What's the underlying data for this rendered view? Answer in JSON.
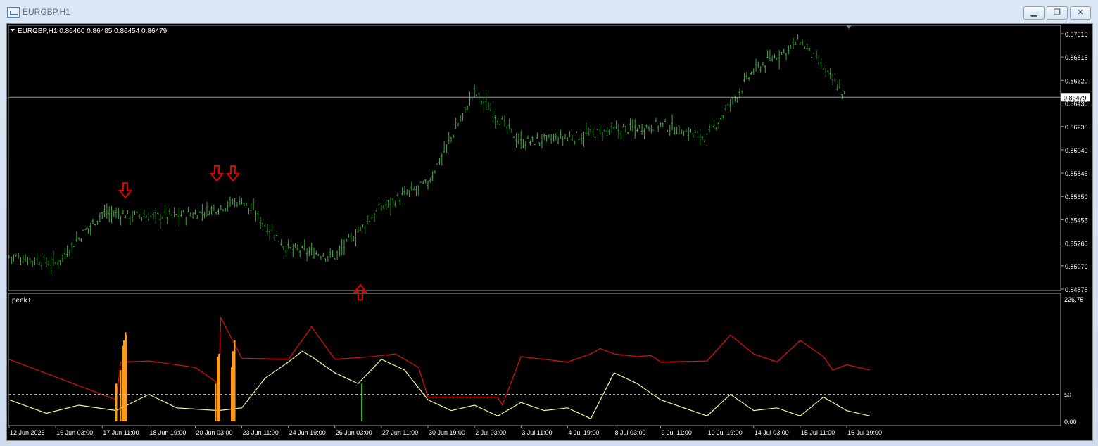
{
  "window": {
    "title": "EURGBP,H1"
  },
  "symbol_info": {
    "text": "EURGBP,H1  0.86460 0.86485 0.86454 0.86479"
  },
  "price_axis": {
    "ticks": [
      "0.87010",
      "0.86815",
      "0.86620",
      "0.86430",
      "0.86235",
      "0.86040",
      "0.85845",
      "0.85650",
      "0.85455",
      "0.85260",
      "0.85070",
      "0.84875"
    ],
    "current_price": "0.86479"
  },
  "indicator": {
    "name": "peek+",
    "ticks": [
      "226.75",
      "50",
      "0.00"
    ],
    "level_value": 50
  },
  "time_axis": {
    "labels": [
      "12 Jun 2025",
      "16 Jun 03:00",
      "17 Jun 11:00",
      "18 Jun 19:00",
      "20 Jun 03:00",
      "23 Jun 11:00",
      "24 Jun 19:00",
      "26 Jun 03:00",
      "27 Jun 11:00",
      "30 Jun 19:00",
      "2 Jul 03:00",
      "3 Jul 11:00",
      "4 Jul 19:00",
      "8 Jul 03:00",
      "9 Jul 11:00",
      "10 Jul 19:00",
      "14 Jul 03:00",
      "15 Jul 11:00",
      "16 Jul 19:00"
    ]
  },
  "colors": {
    "price_bars": "#3fae3a",
    "arrows": "#e00000",
    "indicator_red": "#e01010",
    "indicator_yellow": "#f4f4a0",
    "indicator_orange": "#ff9a1a",
    "indicator_green": "#21c021",
    "background": "#000000"
  },
  "arrows": [
    {
      "type": "down",
      "time_index": 8.4
    },
    {
      "type": "down",
      "time_index": 14.7
    },
    {
      "type": "down",
      "time_index": 16.0
    },
    {
      "type": "up",
      "time_index": 25.0
    }
  ],
  "chart_data": {
    "type": "ohlc",
    "series": [
      {
        "name": "EURGBP,H1",
        "x": [
          "12 Jun 2025",
          "16 Jun 03:00",
          "17 Jun 11:00",
          "18 Jun 19:00",
          "20 Jun 03:00",
          "23 Jun 11:00",
          "24 Jun 19:00",
          "26 Jun 03:00",
          "27 Jun 11:00",
          "30 Jun 19:00",
          "2 Jul 03:00",
          "3 Jul 11:00",
          "4 Jul 19:00",
          "8 Jul 03:00",
          "9 Jul 11:00",
          "10 Jul 19:00",
          "14 Jul 03:00",
          "15 Jul 11:00",
          "16 Jul 19:00"
        ],
        "close": [
          0.8515,
          0.8509,
          0.8551,
          0.8548,
          0.855,
          0.8562,
          0.8521,
          0.8515,
          0.8556,
          0.8576,
          0.8652,
          0.861,
          0.8614,
          0.862,
          0.8625,
          0.8614,
          0.867,
          0.8695,
          0.8648
        ]
      }
    ],
    "ylim": [
      0.84875,
      0.8701
    ],
    "current_price": 0.86479,
    "indicator": {
      "name": "peek+",
      "ylim": [
        0,
        226.75
      ],
      "level": 50,
      "series": [
        {
          "color": "red",
          "x": [
            0,
            2.3,
            2.4,
            3,
            4,
            4.5,
            4.55,
            5,
            6,
            6.5,
            7,
            7.8,
            8.3,
            8.6,
            8.8,
            9,
            9.5,
            10,
            10.5,
            10.6,
            11,
            12,
            12.5,
            12.7,
            13,
            13.5,
            13.8,
            14,
            15,
            15.5,
            16,
            16.5,
            17,
            17.5,
            17.7,
            18,
            18.5
          ],
          "values": [
            115,
            40,
            110,
            112,
            100,
            70,
            192,
            117,
            115,
            175,
            115,
            120,
            125,
            110,
            100,
            45,
            45,
            45,
            45,
            30,
            120,
            110,
            125,
            135,
            125,
            120,
            122,
            110,
            112,
            160,
            125,
            110,
            150,
            120,
            95,
            105,
            95
          ]
        },
        {
          "color": "yellow",
          "x": [
            0,
            0.8,
            1.5,
            2.3,
            3,
            3.6,
            4.5,
            5,
            5.5,
            6,
            6.3,
            6.5,
            7,
            7.5,
            8,
            8.5,
            9,
            9.5,
            10,
            10.5,
            11,
            11.5,
            12,
            12.5,
            13,
            13.5,
            14,
            14.5,
            15,
            15.5,
            16,
            16.5,
            17,
            17.5,
            18,
            18.5
          ],
          "values": [
            40,
            15,
            30,
            20,
            50,
            25,
            20,
            25,
            80,
            110,
            130,
            120,
            90,
            70,
            115,
            95,
            40,
            20,
            30,
            10,
            35,
            20,
            25,
            5,
            90,
            70,
            40,
            25,
            10,
            50,
            20,
            25,
            10,
            45,
            20,
            10
          ]
        }
      ]
    },
    "xlabel": "",
    "ylabel": ""
  }
}
